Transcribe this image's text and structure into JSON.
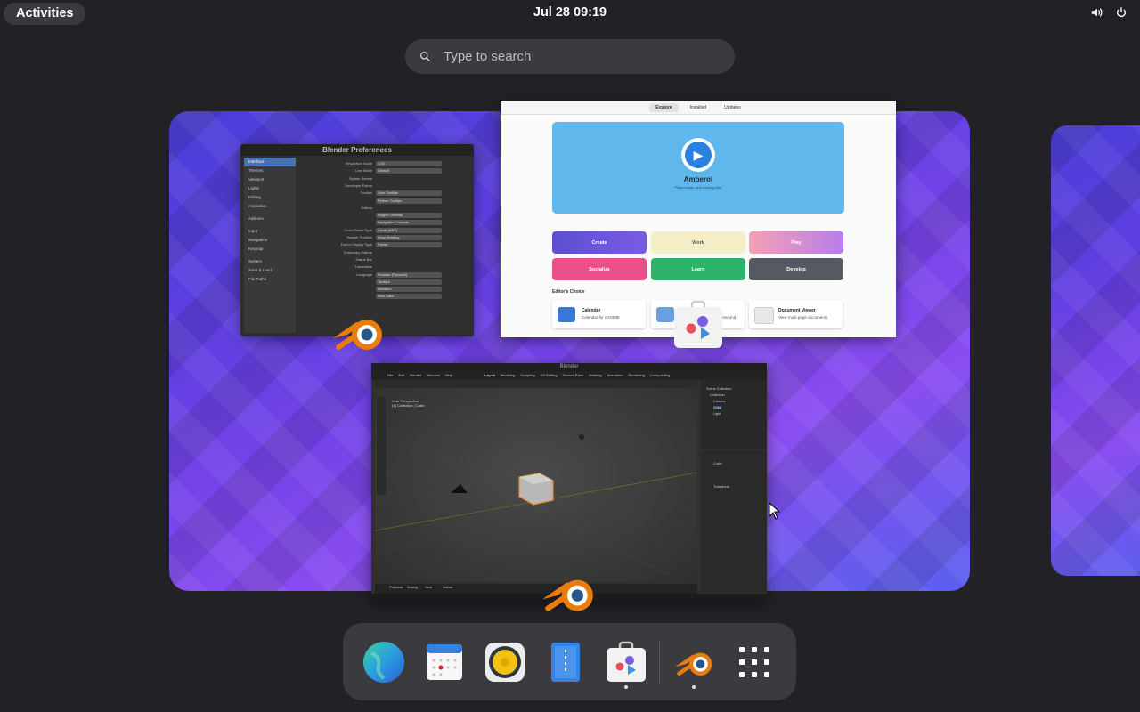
{
  "topbar": {
    "activities": "Activities",
    "clock": "Jul 28  09:19",
    "volume_icon": "speaker-icon",
    "power_icon": "power-icon"
  },
  "search": {
    "placeholder": "Type to search"
  },
  "windows": {
    "prefs": {
      "title": "Blender Preferences",
      "sidebar": [
        "Interface",
        "Themes",
        "Viewport",
        "Lights",
        "Editing",
        "Animation",
        "",
        "Add-ons",
        "",
        "Input",
        "Navigation",
        "Keymap",
        "",
        "System",
        "Save & Load",
        "File Paths"
      ],
      "rows": [
        {
          "label": "Resolution Scale",
          "value": "1.00"
        },
        {
          "label": "Line Width",
          "value": "Default"
        },
        {
          "label": "Splash Screen",
          "value": ""
        },
        {
          "label": "Developer Extras",
          "value": ""
        },
        {
          "label": "Tooltips",
          "value": "User Tooltips"
        },
        {
          "label": "",
          "value": "Python Tooltips"
        },
        {
          "label": "Editors",
          "value": ""
        },
        {
          "label": "",
          "value": "Region Overlap"
        },
        {
          "label": "",
          "value": "Navigation Controls"
        },
        {
          "label": "Color Picker Type",
          "value": "Circle (HSV)"
        },
        {
          "label": "Header Position",
          "value": "Keep Existing"
        },
        {
          "label": "Factor Display Type",
          "value": "Factor"
        },
        {
          "label": "Temporary Editors",
          "value": ""
        },
        {
          "label": "Status Bar",
          "value": ""
        },
        {
          "label": "Translation",
          "value": ""
        },
        {
          "label": "Language",
          "value": "Russian (Русский)"
        },
        {
          "label": "",
          "value": "Tooltips"
        },
        {
          "label": "",
          "value": "Interface"
        },
        {
          "label": "",
          "value": "New Data"
        }
      ]
    },
    "software": {
      "tabs": [
        "Explore",
        "Installed",
        "Updates"
      ],
      "banner_name": "Amberol",
      "banner_tag": "Plays music, and nothing else",
      "categories": [
        "Create",
        "Work",
        "Play",
        "Socialize",
        "Learn",
        "Develop"
      ],
      "editors_choice": "Editor's Choice",
      "cards": [
        {
          "title": "Calendar",
          "sub": "Calendar for GNOME"
        },
        {
          "title": "",
          "sub": "Second"
        },
        {
          "title": "Document Viewer",
          "sub": "View multi-page documents"
        }
      ]
    },
    "blender": {
      "title": "Blender",
      "menus": [
        "File",
        "Edit",
        "Render",
        "Window",
        "Help"
      ],
      "workspaces": [
        "Layout",
        "Modeling",
        "Sculpting",
        "UV Editing",
        "Texture Paint",
        "Shading",
        "Animation",
        "Rendering",
        "Compositing"
      ],
      "viewport_label": "User Perspective",
      "viewport_sub": "(1) Collection | Cube",
      "outliner": [
        "Scene Collection",
        "Collection",
        "Camera",
        "Cube",
        "Light"
      ],
      "props_object": "Cube",
      "props_section": "Transform",
      "timeline": [
        "Playback",
        "Keying",
        "View",
        "Marker"
      ]
    }
  },
  "dash": {
    "items": [
      "globe-icon",
      "calendar-icon",
      "speaker-icon",
      "document-viewer-icon",
      "software-icon",
      "blender-icon",
      "app-grid-icon"
    ]
  },
  "colors": {
    "topbar_bg": "#222226",
    "blender_orange": "#e87d0d",
    "blender_blue": "#265787",
    "software_banner": "#60b7ec"
  }
}
